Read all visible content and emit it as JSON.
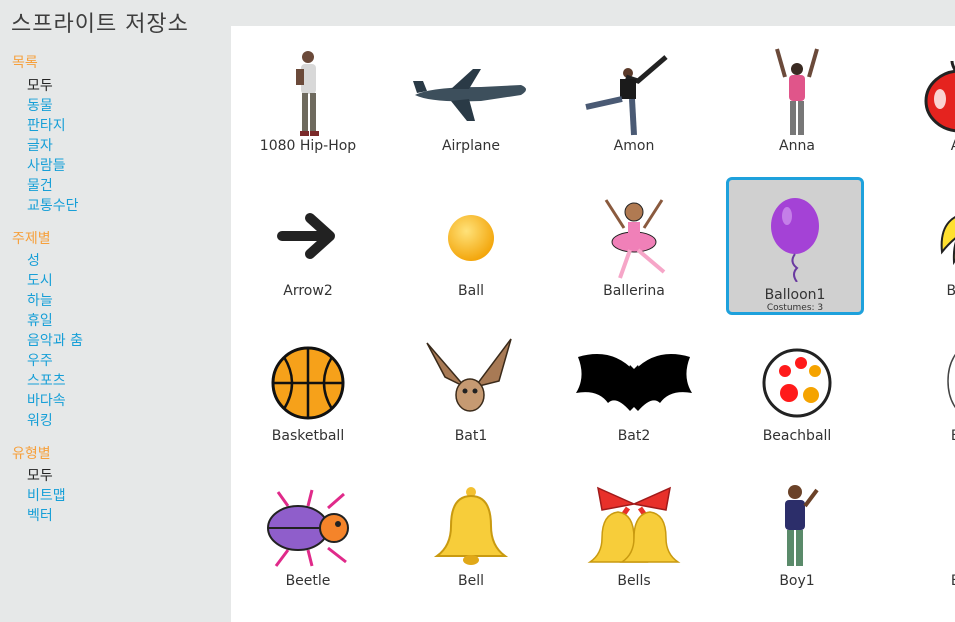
{
  "header": {
    "title": "스프라이트 저장소"
  },
  "sidebar": {
    "category": {
      "heading": "목록",
      "items": [
        "모두",
        "동물",
        "판타지",
        "글자",
        "사람들",
        "물건",
        "교통수단"
      ]
    },
    "theme": {
      "heading": "주제별",
      "items": [
        "성",
        "도시",
        "하늘",
        "휴일",
        "음악과 춤",
        "우주",
        "스포츠",
        "바다속",
        "워킹"
      ]
    },
    "type": {
      "heading": "유형별",
      "items": [
        "모두",
        "비트맵",
        "벡터"
      ]
    }
  },
  "sprites": [
    {
      "name": "1080 Hip-Hop",
      "icon": "hiphop-dancer-icon"
    },
    {
      "name": "Airplane",
      "icon": "airplane-icon"
    },
    {
      "name": "Amon",
      "icon": "amon-dancer-icon"
    },
    {
      "name": "Anna",
      "icon": "anna-girl-icon"
    },
    {
      "name": "Ap",
      "icon": "apple-icon"
    },
    {
      "name": "Arrow2",
      "icon": "arrow-icon"
    },
    {
      "name": "Ball",
      "icon": "ball-icon"
    },
    {
      "name": "Ballerina",
      "icon": "ballerina-icon"
    },
    {
      "name": "Balloon1",
      "icon": "balloon-icon",
      "costumes": "Costumes: 3"
    },
    {
      "name": "Ban",
      "icon": "banana-icon"
    },
    {
      "name": "Basketball",
      "icon": "basketball-icon"
    },
    {
      "name": "Bat1",
      "icon": "bat-brown-icon"
    },
    {
      "name": "Bat2",
      "icon": "bat-black-icon"
    },
    {
      "name": "Beachball",
      "icon": "beachball-icon"
    },
    {
      "name": "Be",
      "icon": "bear-icon"
    },
    {
      "name": "Beetle",
      "icon": "beetle-icon"
    },
    {
      "name": "Bell",
      "icon": "bell-icon"
    },
    {
      "name": "Bells",
      "icon": "bells-icon"
    },
    {
      "name": "Boy1",
      "icon": "boy-icon"
    },
    {
      "name": "Be",
      "icon": "partial-sprite-icon"
    }
  ],
  "selected_sprite": "Balloon1",
  "colors": {
    "accent": "#1ea1dc",
    "section_heading": "#f6a03c",
    "link": "#179fd7"
  }
}
